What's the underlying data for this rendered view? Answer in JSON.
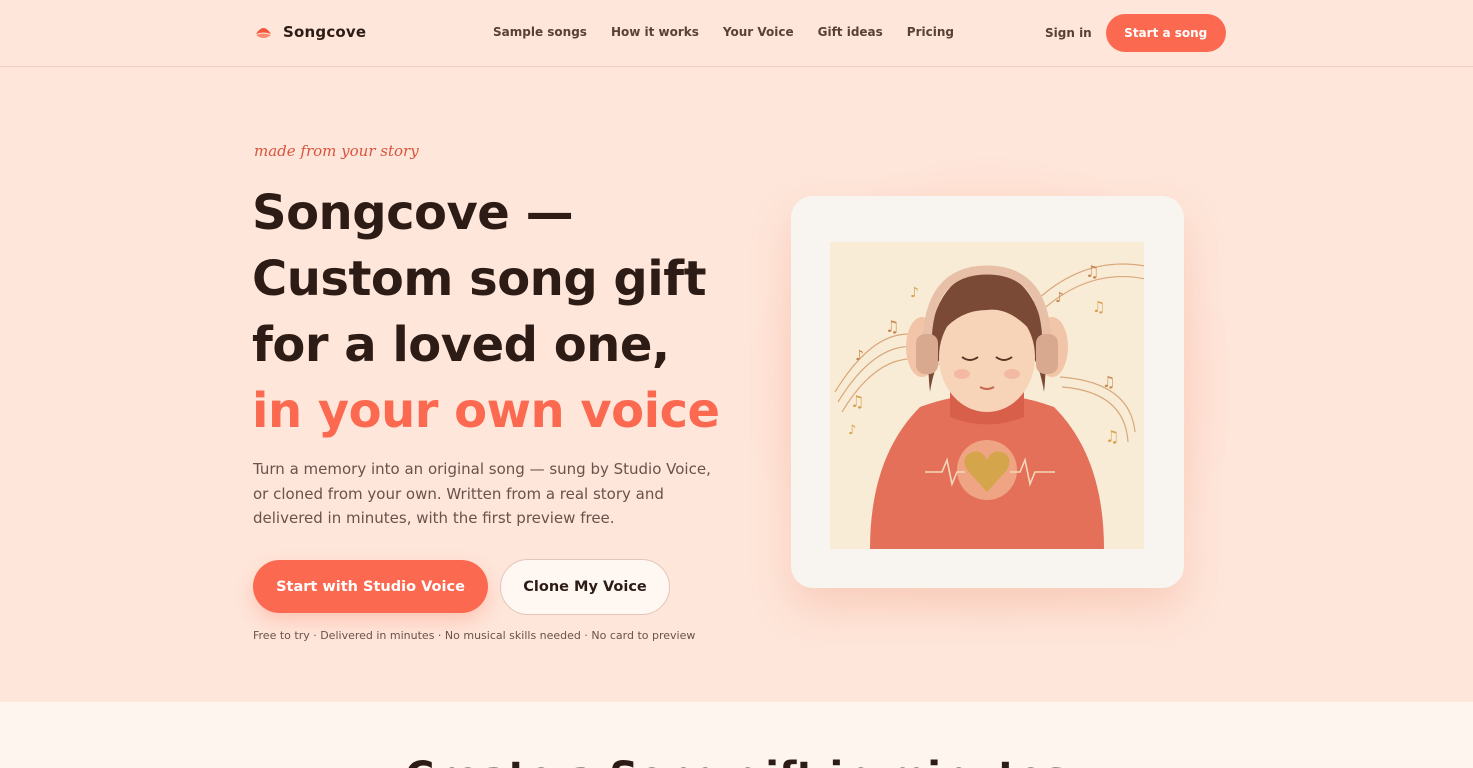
{
  "brand": {
    "name": "Songcove",
    "logo_icon": "songcove-logo-icon",
    "color": "#fb6a50"
  },
  "nav": {
    "links": [
      "Sample songs",
      "How it works",
      "Your Voice",
      "Gift ideas",
      "Pricing"
    ],
    "sign_in": "Sign in",
    "cta": "Start a song"
  },
  "hero": {
    "eyebrow": "made from your story",
    "headline_lines": [
      "Songcove —",
      "Custom song gift",
      "for a loved one,"
    ],
    "headline_accent": "in your own voice",
    "subtitle": "Turn a memory into an original song — sung by Studio Voice, or cloned from your own. Written from a real story and delivered in minutes, with the first preview free.",
    "primary_cta": "Start with Studio Voice",
    "secondary_cta": "Clone My Voice",
    "perks": "Free to try · Delivered in minutes · No musical skills needed · No card to preview",
    "image_icon": "girl-with-headphones-illustration"
  },
  "next_section": {
    "title": "Create a Song gift in minutes"
  },
  "colors": {
    "background": "#fee6da",
    "accent": "#fb6a50",
    "text": "#2d1c16",
    "muted": "#6b524a"
  }
}
